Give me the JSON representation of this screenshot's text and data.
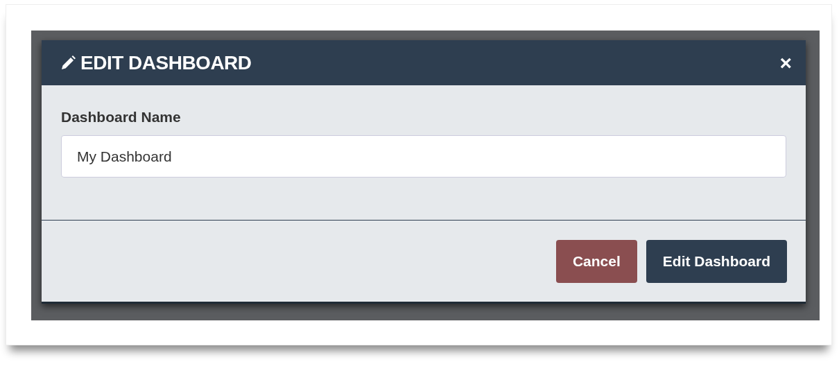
{
  "modal": {
    "title": "EDIT DASHBOARD",
    "close": "×"
  },
  "form": {
    "label": "Dashboard Name",
    "value": "My Dashboard"
  },
  "buttons": [
    {
      "label": "Cancel",
      "kind": "cancel"
    },
    {
      "label": "Edit Dashboard",
      "kind": "primary"
    }
  ]
}
